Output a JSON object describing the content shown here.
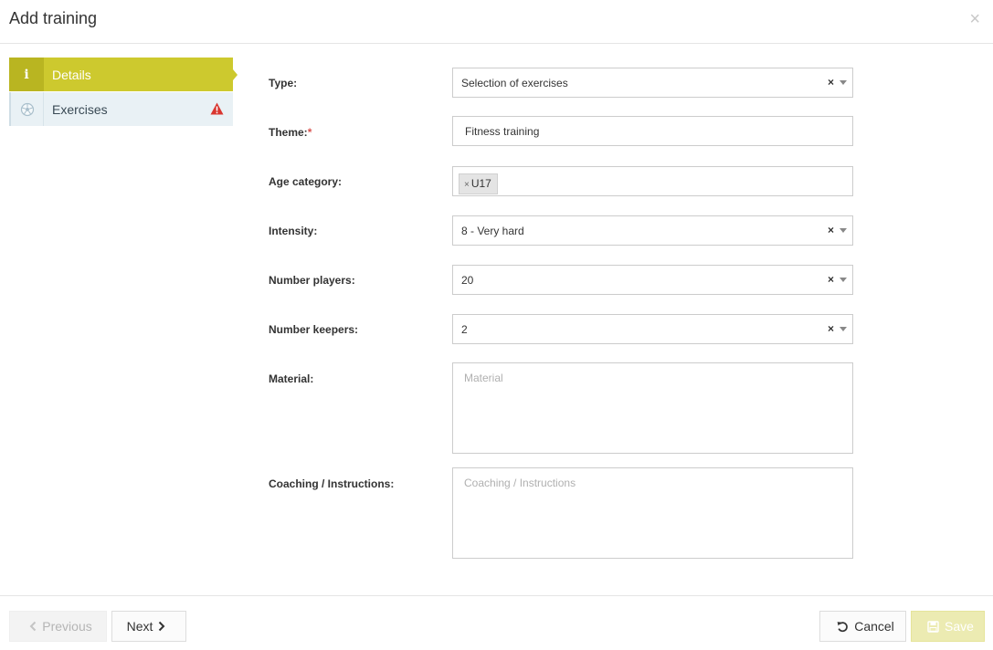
{
  "header": {
    "title": "Add training",
    "close_glyph": "×"
  },
  "sidebar": {
    "items": [
      {
        "label": "Details",
        "icon": "info-icon",
        "active": true
      },
      {
        "label": "Exercises",
        "icon": "soccer-ball-icon",
        "active": false,
        "warning": true
      }
    ]
  },
  "form": {
    "type": {
      "label": "Type:",
      "value": "Selection of exercises"
    },
    "theme": {
      "label": "Theme:",
      "required_mark": "*",
      "value": "Fitness training"
    },
    "age_category": {
      "label": "Age category:",
      "tags": [
        "U17"
      ],
      "tag_remove_glyph": "×"
    },
    "intensity": {
      "label": "Intensity:",
      "value": "8 - Very hard"
    },
    "number_players": {
      "label": "Number players:",
      "value": "20"
    },
    "number_keepers": {
      "label": "Number keepers:",
      "value": "2"
    },
    "material": {
      "label": "Material:",
      "placeholder": "Material",
      "value": ""
    },
    "coaching": {
      "label": "Coaching / Instructions:",
      "placeholder": "Coaching / Instructions",
      "value": ""
    },
    "clear_glyph": "×"
  },
  "footer": {
    "previous_label": "Previous",
    "next_label": "Next",
    "cancel_label": "Cancel",
    "save_label": "Save"
  },
  "colors": {
    "accent": "#cdc92e",
    "accent_dark": "#b9b521",
    "save_disabled": "#ecebb2",
    "warning": "#d9362f",
    "required": "#d9534f"
  }
}
